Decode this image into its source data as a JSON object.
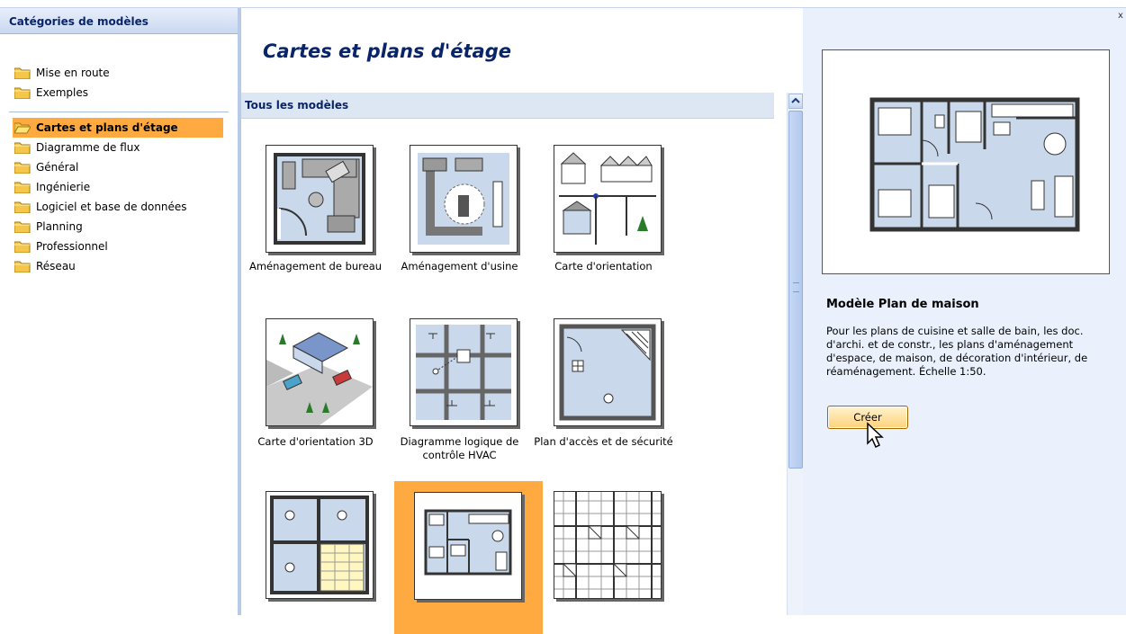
{
  "left_panel": {
    "title": "Catégories de modèles",
    "group1": [
      {
        "label": "Mise en route"
      },
      {
        "label": "Exemples"
      }
    ],
    "group2": [
      {
        "label": "Cartes et plans d'étage",
        "selected": true
      },
      {
        "label": "Diagramme de flux"
      },
      {
        "label": "Général"
      },
      {
        "label": "Ingénierie"
      },
      {
        "label": "Logiciel et base de données"
      },
      {
        "label": "Planning"
      },
      {
        "label": "Professionnel"
      },
      {
        "label": "Réseau"
      }
    ],
    "folder_color": "#f5c64a",
    "selected_color": "#ffaa40"
  },
  "main": {
    "title": "Cartes et plans d'étage",
    "section": "Tous les modèles",
    "tiles": [
      {
        "label": "Aménagement de bureau"
      },
      {
        "label": "Aménagement d'usine"
      },
      {
        "label": "Carte d'orientation"
      },
      {
        "label": "Carte d'orientation 3D"
      },
      {
        "label": "Diagramme logique de contrôle HVAC"
      },
      {
        "label": "Plan d'accès et de sécurité"
      },
      {
        "label": ""
      },
      {
        "label": "",
        "selected": true
      },
      {
        "label": ""
      }
    ]
  },
  "right_panel": {
    "close": "x",
    "template_title": "Modèle Plan de maison",
    "description": "Pour les plans de cuisine et salle de bain, les doc. d'archi. et de constr., les plans d'aménagement d'espace, de maison, de décoration d'intérieur, de réaménagement. Échelle 1:50.",
    "create_label": "Créer"
  }
}
